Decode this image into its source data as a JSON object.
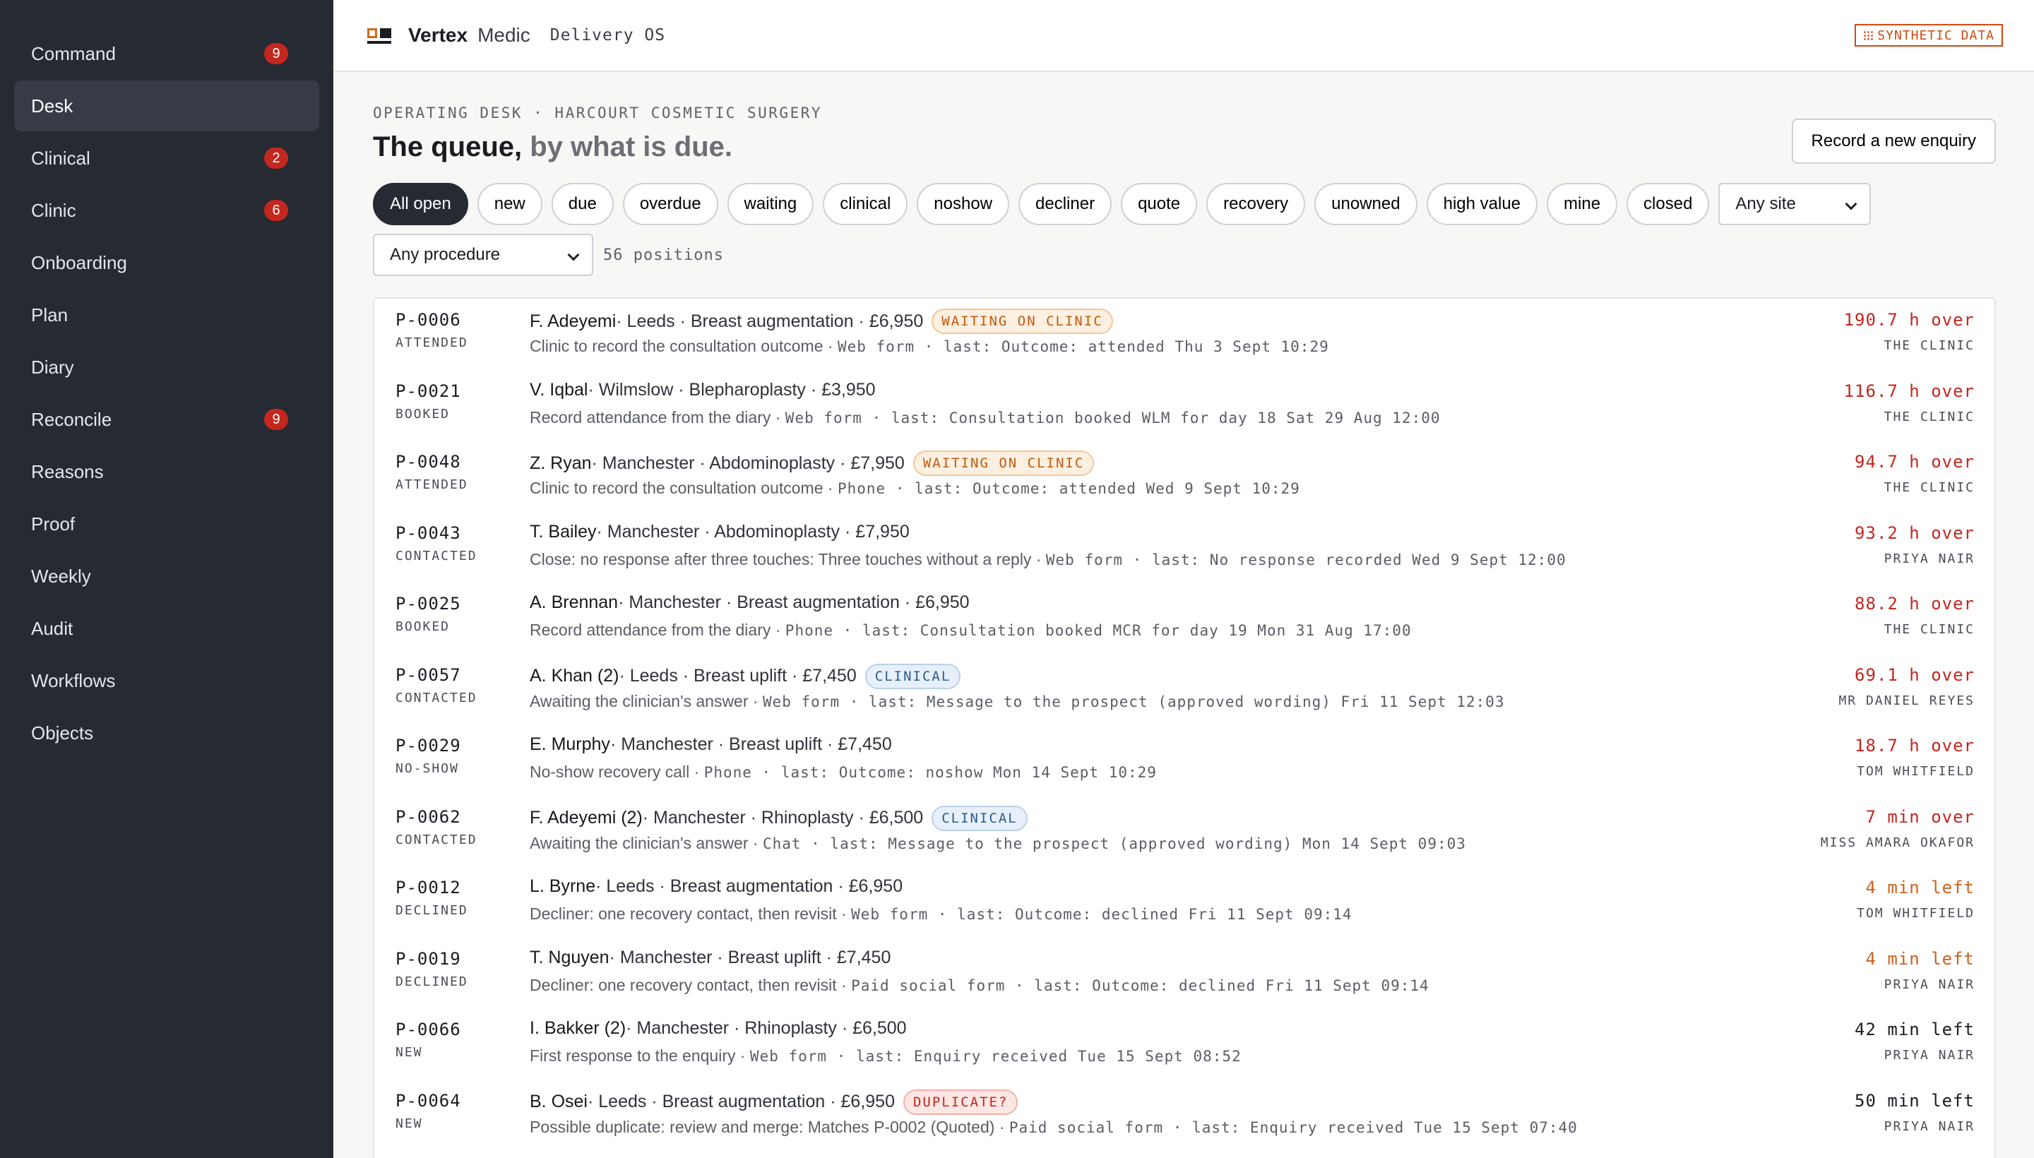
{
  "sidebar": {
    "items": [
      {
        "label": "Command",
        "badge": "9"
      },
      {
        "label": "Desk",
        "badge": ""
      },
      {
        "label": "Clinical",
        "badge": "2"
      },
      {
        "label": "Clinic",
        "badge": "6"
      },
      {
        "label": "Onboarding",
        "badge": ""
      },
      {
        "label": "Plan",
        "badge": ""
      },
      {
        "label": "Diary",
        "badge": ""
      },
      {
        "label": "Reconcile",
        "badge": "9"
      },
      {
        "label": "Reasons",
        "badge": ""
      },
      {
        "label": "Proof",
        "badge": ""
      },
      {
        "label": "Weekly",
        "badge": ""
      },
      {
        "label": "Audit",
        "badge": ""
      },
      {
        "label": "Workflows",
        "badge": ""
      },
      {
        "label": "Objects",
        "badge": ""
      }
    ],
    "active_index": 1
  },
  "header": {
    "brand_primary": "Vertex",
    "brand_secondary": "Medic",
    "product": "Delivery OS",
    "synthetic_label": "SYNTHETIC DATA"
  },
  "page": {
    "eyebrow": "OPERATING DESK · HARCOURT COSMETIC SURGERY",
    "title": "The queue,",
    "subtitle": "by what is due.",
    "record_button": "Record a new enquiry"
  },
  "filters": {
    "chips": [
      "All open",
      "new",
      "due",
      "overdue",
      "waiting",
      "clinical",
      "noshow",
      "decliner",
      "quote",
      "recovery",
      "unowned",
      "high value",
      "mine",
      "closed"
    ],
    "active_chip": 0,
    "site_select": "Any site",
    "procedure_select": "Any procedure",
    "count": "56 positions"
  },
  "queue": [
    {
      "id": "P-0006",
      "status": "ATTENDED",
      "name": "F. Adeyemi",
      "details": " · Leeds · Breast augmentation · £6,950",
      "tag": "WAITING ON CLINIC",
      "tag_kind": "waiting",
      "action": "Clinic to record the consultation outcome · ",
      "meta": "Web form · last: Outcome: attended Thu 3 Sept 10:29",
      "due": "190.7 h over",
      "due_kind": "over",
      "owner": "THE CLINIC"
    },
    {
      "id": "P-0021",
      "status": "BOOKED",
      "name": "V. Iqbal",
      "details": " · Wilmslow · Blepharoplasty · £3,950",
      "tag": "",
      "tag_kind": "",
      "action": "Record attendance from the diary · ",
      "meta": "Web form · last: Consultation booked WLM for day 18 Sat 29 Aug 12:00",
      "due": "116.7 h over",
      "due_kind": "over",
      "owner": "THE CLINIC"
    },
    {
      "id": "P-0048",
      "status": "ATTENDED",
      "name": "Z. Ryan",
      "details": " · Manchester · Abdominoplasty · £7,950",
      "tag": "WAITING ON CLINIC",
      "tag_kind": "waiting",
      "action": "Clinic to record the consultation outcome · ",
      "meta": "Phone · last: Outcome: attended Wed 9 Sept 10:29",
      "due": "94.7 h over",
      "due_kind": "over",
      "owner": "THE CLINIC"
    },
    {
      "id": "P-0043",
      "status": "CONTACTED",
      "name": "T. Bailey",
      "details": " · Manchester · Abdominoplasty · £7,950",
      "tag": "",
      "tag_kind": "",
      "action": "Close: no response after three touches: Three touches without a reply · ",
      "meta": "Web form · last: No response recorded Wed 9 Sept 12:00",
      "due": "93.2 h over",
      "due_kind": "over",
      "owner": "PRIYA NAIR"
    },
    {
      "id": "P-0025",
      "status": "BOOKED",
      "name": "A. Brennan",
      "details": " · Manchester · Breast augmentation · £6,950",
      "tag": "",
      "tag_kind": "",
      "action": "Record attendance from the diary · ",
      "meta": "Phone · last: Consultation booked MCR for day 19 Mon 31 Aug 17:00",
      "due": "88.2 h over",
      "due_kind": "over",
      "owner": "THE CLINIC"
    },
    {
      "id": "P-0057",
      "status": "CONTACTED",
      "name": "A. Khan (2)",
      "details": " · Leeds · Breast uplift · £7,450",
      "tag": "CLINICAL",
      "tag_kind": "clinical",
      "action": "Awaiting the clinician's answer · ",
      "meta": "Web form · last: Message to the prospect (approved wording) Fri 11 Sept 12:03",
      "due": "69.1 h over",
      "due_kind": "over",
      "owner": "MR DANIEL REYES"
    },
    {
      "id": "P-0029",
      "status": "NO-SHOW",
      "name": "E. Murphy",
      "details": " · Manchester · Breast uplift · £7,450",
      "tag": "",
      "tag_kind": "",
      "action": "No-show recovery call · ",
      "meta": "Phone · last: Outcome: noshow Mon 14 Sept 10:29",
      "due": "18.7 h over",
      "due_kind": "over",
      "owner": "TOM WHITFIELD"
    },
    {
      "id": "P-0062",
      "status": "CONTACTED",
      "name": "F. Adeyemi (2)",
      "details": " · Manchester · Rhinoplasty · £6,500",
      "tag": "CLINICAL",
      "tag_kind": "clinical",
      "action": "Awaiting the clinician's answer · ",
      "meta": "Chat · last: Message to the prospect (approved wording) Mon 14 Sept 09:03",
      "due": "7 min over",
      "due_kind": "over",
      "owner": "MISS AMARA OKAFOR"
    },
    {
      "id": "P-0012",
      "status": "DECLINED",
      "name": "L. Byrne",
      "details": " · Leeds · Breast augmentation · £6,950",
      "tag": "",
      "tag_kind": "",
      "action": "Decliner: one recovery contact, then revisit · ",
      "meta": "Web form · last: Outcome: declined Fri 11 Sept 09:14",
      "due": "4 min left",
      "due_kind": "left",
      "owner": "TOM WHITFIELD"
    },
    {
      "id": "P-0019",
      "status": "DECLINED",
      "name": "T. Nguyen",
      "details": " · Manchester · Breast uplift · £7,450",
      "tag": "",
      "tag_kind": "",
      "action": "Decliner: one recovery contact, then revisit · ",
      "meta": "Paid social form · last: Outcome: declined Fri 11 Sept 09:14",
      "due": "4 min left",
      "due_kind": "left",
      "owner": "PRIYA NAIR"
    },
    {
      "id": "P-0066",
      "status": "NEW",
      "name": "I. Bakker (2)",
      "details": " · Manchester · Rhinoplasty · £6,500",
      "tag": "",
      "tag_kind": "",
      "action": "First response to the enquiry · ",
      "meta": "Web form · last: Enquiry received Tue 15 Sept 08:52",
      "due": "42 min left",
      "due_kind": "ok",
      "owner": "PRIYA NAIR"
    },
    {
      "id": "P-0064",
      "status": "NEW",
      "name": "B. Osei",
      "details": " · Leeds · Breast augmentation · £6,950",
      "tag": "DUPLICATE?",
      "tag_kind": "duplicate",
      "action": "Possible duplicate: review and merge: Matches P-0002 (Quoted) · ",
      "meta": "Paid social form · last: Enquiry received Tue 15 Sept 07:40",
      "due": "50 min left",
      "due_kind": "ok",
      "owner": "PRIYA NAIR"
    }
  ]
}
